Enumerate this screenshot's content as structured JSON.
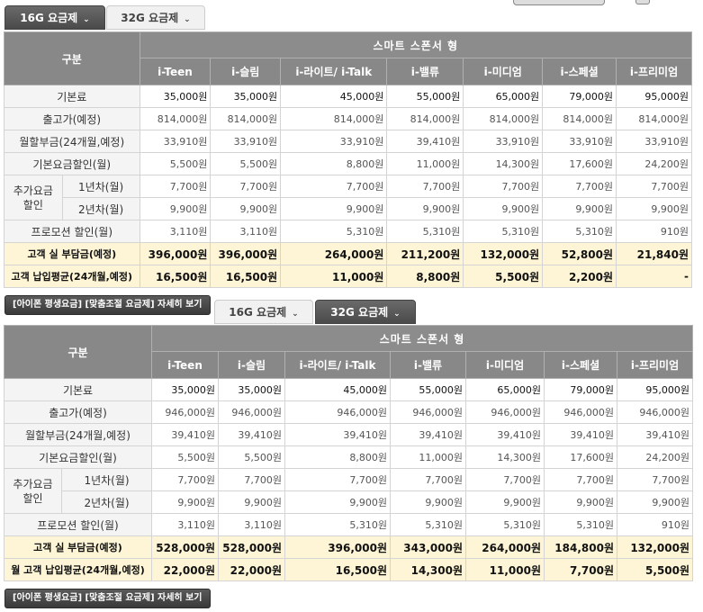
{
  "tabs_a": [
    {
      "label": "16G 요금제",
      "chev": "⌄",
      "active": true
    },
    {
      "label": "32G 요금제",
      "chev": "⌄",
      "active": false
    }
  ],
  "tabs_b": [
    {
      "label": "16G 요금제",
      "chev": "⌄",
      "active": false
    },
    {
      "label": "32G 요금제",
      "chev": "⌄",
      "active": true
    }
  ],
  "table_a": {
    "gubun": "구분",
    "group": "스마트 스폰서 형",
    "columns": [
      "i-Teen",
      "i-슬림",
      "i-라이트/ i-Talk",
      "i-밸류",
      "i-미디엄",
      "i-스페셜",
      "i-프리미엄"
    ],
    "rows": {
      "basic": {
        "label": "기본료",
        "values": [
          "35,000원",
          "35,000원",
          "45,000원",
          "55,000원",
          "65,000원",
          "79,000원",
          "95,000원"
        ]
      },
      "price": {
        "label": "출고가(예정)",
        "values": [
          "814,000원",
          "814,000원",
          "814,000원",
          "814,000원",
          "814,000원",
          "814,000원",
          "814,000원"
        ]
      },
      "installment": {
        "label": "월할부금(24개월,예정)",
        "values": [
          "33,910원",
          "33,910원",
          "33,910원",
          "39,410원",
          "33,910원",
          "33,910원",
          "33,910원"
        ]
      },
      "basic_discount": {
        "label": "기본요금할인(월)",
        "values": [
          "5,500원",
          "5,500원",
          "8,800원",
          "11,000원",
          "14,300원",
          "17,600원",
          "24,200원"
        ]
      },
      "extra_label": "추가요금 할인",
      "year1": {
        "label": "1년차(월)",
        "values": [
          "7,700원",
          "7,700원",
          "7,700원",
          "7,700원",
          "7,700원",
          "7,700원",
          "7,700원"
        ]
      },
      "year2": {
        "label": "2년차(월)",
        "values": [
          "9,900원",
          "9,900원",
          "9,900원",
          "9,900원",
          "9,900원",
          "9,900원",
          "9,900원"
        ]
      },
      "promo": {
        "label": "프로모션 할인(월)",
        "values": [
          "3,110원",
          "3,110원",
          "5,310원",
          "5,310원",
          "5,310원",
          "5,310원",
          "910원"
        ]
      },
      "burden": {
        "label": "고객 실 부담금(예정)",
        "values": [
          "396,000원",
          "396,000원",
          "264,000원",
          "211,200원",
          "132,000원",
          "52,800원",
          "21,840원"
        ]
      },
      "avg": {
        "label": "고객 납입평균(24개월,예정)",
        "values": [
          "16,500원",
          "16,500원",
          "11,000원",
          "8,800원",
          "5,500원",
          "2,200원",
          "-"
        ]
      }
    }
  },
  "table_b": {
    "gubun": "구분",
    "group": "스마트 스폰서 형",
    "columns": [
      "i-Teen",
      "i-슬림",
      "i-라이트/ i-Talk",
      "i-밸류",
      "i-미디엄",
      "i-스페셜",
      "i-프리미엄"
    ],
    "rows": {
      "basic": {
        "label": "기본료",
        "values": [
          "35,000원",
          "35,000원",
          "45,000원",
          "55,000원",
          "65,000원",
          "79,000원",
          "95,000원"
        ]
      },
      "price": {
        "label": "출고가(예정)",
        "values": [
          "946,000원",
          "946,000원",
          "946,000원",
          "946,000원",
          "946,000원",
          "946,000원",
          "946,000원"
        ]
      },
      "installment": {
        "label": "월할부금(24개월,예정)",
        "values": [
          "39,410원",
          "39,410원",
          "39,410원",
          "39,410원",
          "39,410원",
          "39,410원",
          "39,410원"
        ]
      },
      "basic_discount": {
        "label": "기본요금할인(월)",
        "values": [
          "5,500원",
          "5,500원",
          "8,800원",
          "11,000원",
          "14,300원",
          "17,600원",
          "24,200원"
        ]
      },
      "extra_label": "추가요금 할인",
      "year1": {
        "label": "1년차(월)",
        "values": [
          "7,700원",
          "7,700원",
          "7,700원",
          "7,700원",
          "7,700원",
          "7,700원",
          "7,700원"
        ]
      },
      "year2": {
        "label": "2년차(월)",
        "values": [
          "9,900원",
          "9,900원",
          "9,900원",
          "9,900원",
          "9,900원",
          "9,900원",
          "9,900원"
        ]
      },
      "promo": {
        "label": "프로모션 할인(월)",
        "values": [
          "3,110원",
          "3,110원",
          "5,310원",
          "5,310원",
          "5,310원",
          "5,310원",
          "910원"
        ]
      },
      "burden": {
        "label": "고객 실 부담금(예정)",
        "values": [
          "528,000원",
          "528,000원",
          "396,000원",
          "343,000원",
          "264,000원",
          "184,800원",
          "132,000원"
        ]
      },
      "avg": {
        "label": "월 고객 납입평균(24개월,예정)",
        "values": [
          "22,000원",
          "22,000원",
          "16,500원",
          "14,300원",
          "11,000원",
          "7,700원",
          "5,500원"
        ]
      }
    }
  },
  "detail_button": "[아이폰 평생요금] [맞춤조절 요금제] 자세히 보기",
  "colors": {
    "header_gray": "#8a8a8a",
    "total_row": "#fdf5d5",
    "label_bg": "#f4f4f4"
  }
}
